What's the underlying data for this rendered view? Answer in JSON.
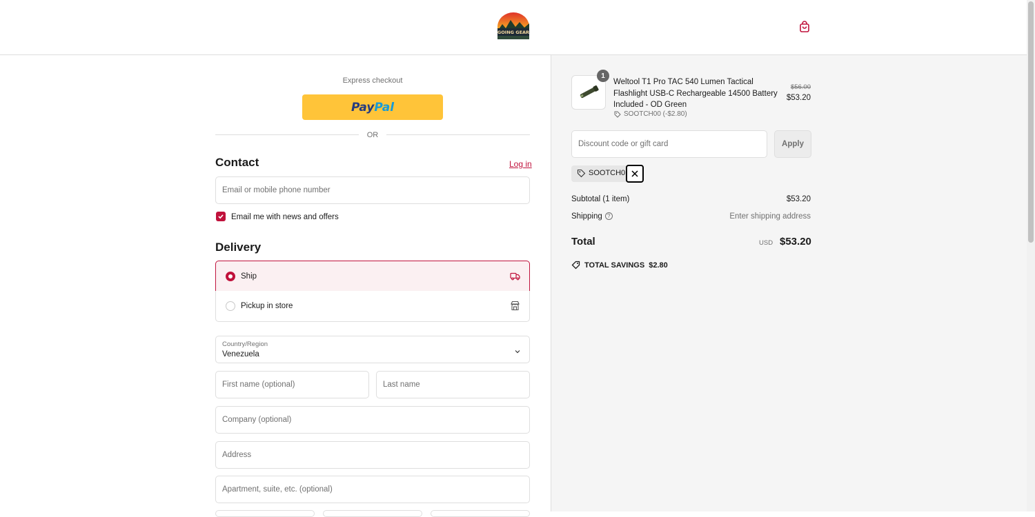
{
  "brand": {
    "logo_icon": "going-gear-logo",
    "logo_text": "GOING GEAR"
  },
  "header": {
    "cart_icon": "shopping-bag-icon"
  },
  "express": {
    "label": "Express checkout",
    "paypal_a": "Pay",
    "paypal_b": "Pal",
    "or_label": "OR"
  },
  "contact": {
    "title": "Contact",
    "login_label": "Log in",
    "email_placeholder": "Email or mobile phone number",
    "news_label": "Email me with news and offers",
    "news_checked": true
  },
  "delivery": {
    "title": "Delivery",
    "options": [
      {
        "label": "Ship",
        "icon": "truck-icon",
        "selected": true
      },
      {
        "label": "Pickup in store",
        "icon": "store-icon",
        "selected": false
      }
    ],
    "country_label": "Country/Region",
    "country_value": "Venezuela",
    "first_name_placeholder": "First name (optional)",
    "last_name_placeholder": "Last name",
    "company_placeholder": "Company (optional)",
    "address_placeholder": "Address",
    "apartment_placeholder": "Apartment, suite, etc. (optional)"
  },
  "order": {
    "item": {
      "quantity": "1",
      "name": "Weltool T1 Pro TAC 540 Lumen Tactical Flashlight USB-C Rechargeable 14500 Battery Included - OD Green",
      "discount": "SOOTCH00 (-$2.80)",
      "old_price": "$56.00",
      "price": "$53.20"
    },
    "discount_placeholder": "Discount code or gift card",
    "apply_label": "Apply",
    "applied_code": "SOOTCH00",
    "subtotal_label": "Subtotal (1 item)",
    "subtotal_value": "$53.20",
    "shipping_label": "Shipping",
    "shipping_value": "Enter shipping address",
    "total_label": "Total",
    "total_currency": "USD",
    "total_value": "$53.20",
    "savings_label": "TOTAL SAVINGS",
    "savings_value": "$2.80"
  },
  "colors": {
    "accent": "#c0123c",
    "paypal": "#ffc439",
    "summary_bg": "#f5f5f5"
  }
}
